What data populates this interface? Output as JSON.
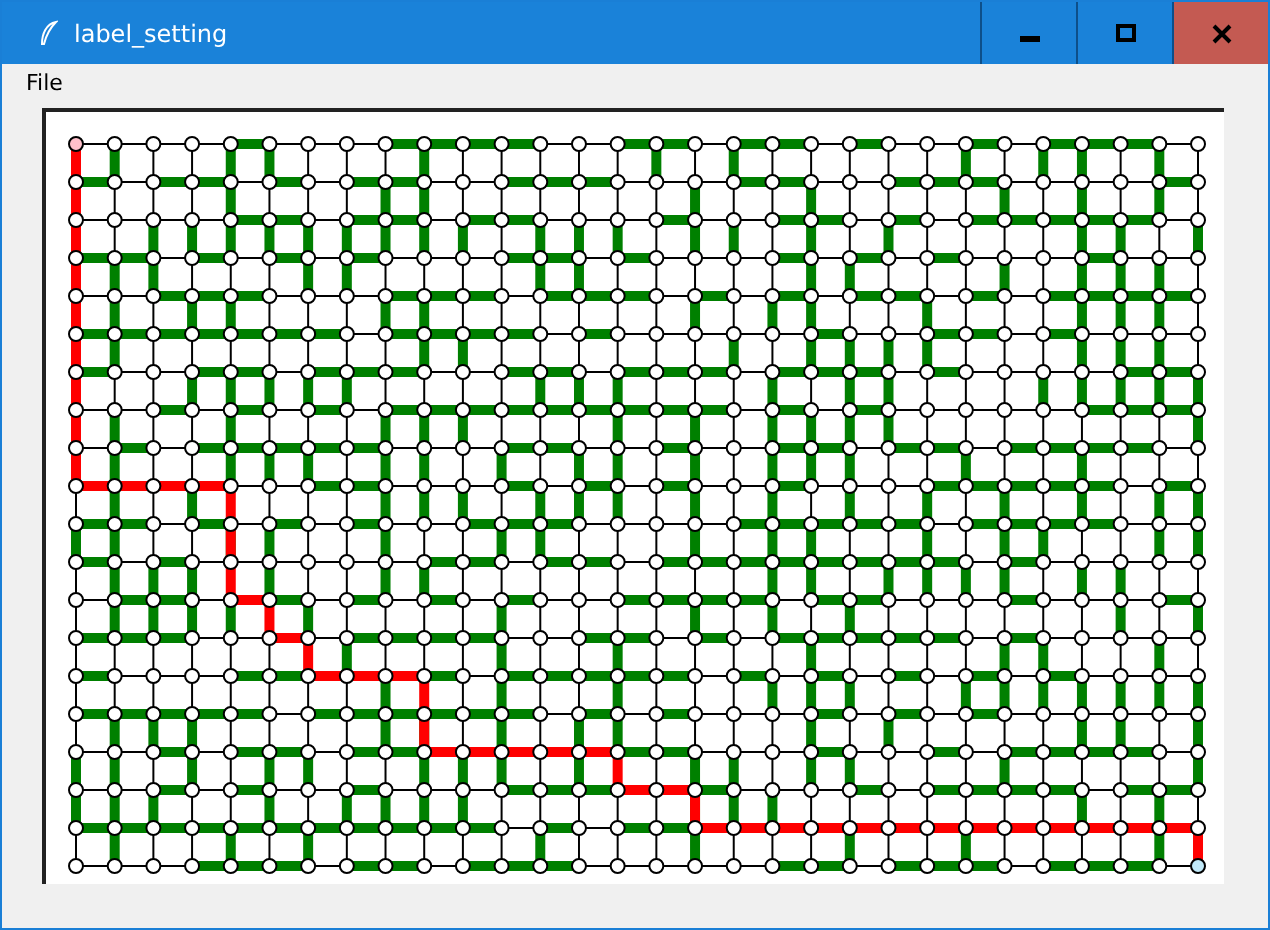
{
  "window": {
    "title": "label_setting"
  },
  "menu": [
    "File"
  ]
}
